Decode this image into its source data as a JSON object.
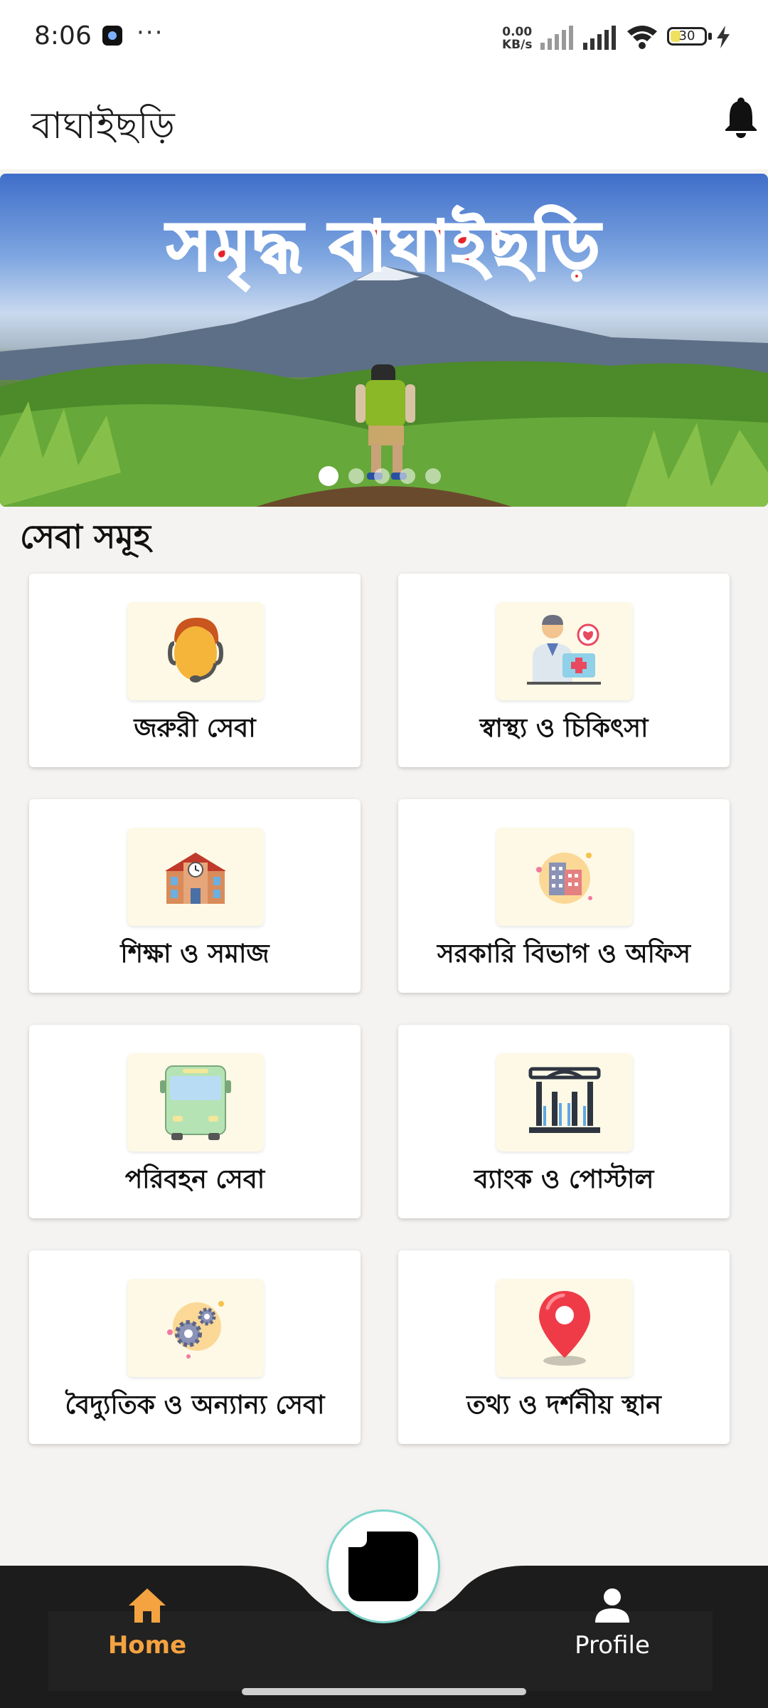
{
  "status_bar": {
    "time": "8:06",
    "more": "···",
    "net_speed_value": "0.00",
    "net_speed_unit": "KB/s",
    "battery": "30",
    "battery_level": 0.3
  },
  "app_bar": {
    "title": "বাঘাইছড়ি"
  },
  "banner": {
    "text": "সমৃদ্ধ বাঘাইছড়ি",
    "slide_count": 5,
    "active_slide": 1
  },
  "section": {
    "title": "সেবা সমূহ"
  },
  "services": [
    {
      "label": "জরুরী সেবা",
      "icon": "support-agent-icon"
    },
    {
      "label": "স্বাস্থ্য ও চিকিৎসা",
      "icon": "doctor-icon"
    },
    {
      "label": "শিক্ষা ও সমাজ",
      "icon": "school-building-icon"
    },
    {
      "label": "সরকারি বিভাগ ও অফিস",
      "icon": "office-building-icon"
    },
    {
      "label": "পরিবহন সেবা",
      "icon": "bus-icon"
    },
    {
      "label": "ব্যাংক ও পোস্টাল",
      "icon": "bank-icon"
    },
    {
      "label": "বৈদ্যুতিক ও অন্যান্য সেবা",
      "icon": "gears-icon"
    },
    {
      "label": "তথ্য ও দর্শনীয় স্থান",
      "icon": "location-pin-icon"
    }
  ],
  "bottom_nav": {
    "home": "Home",
    "profile": "Profile",
    "active": "Home"
  },
  "colors": {
    "accent": "#f4a340",
    "nav_bg": "#1c1c1c",
    "banner_text": "#e6232b",
    "icon_box_bg": "#fdf9e6"
  }
}
